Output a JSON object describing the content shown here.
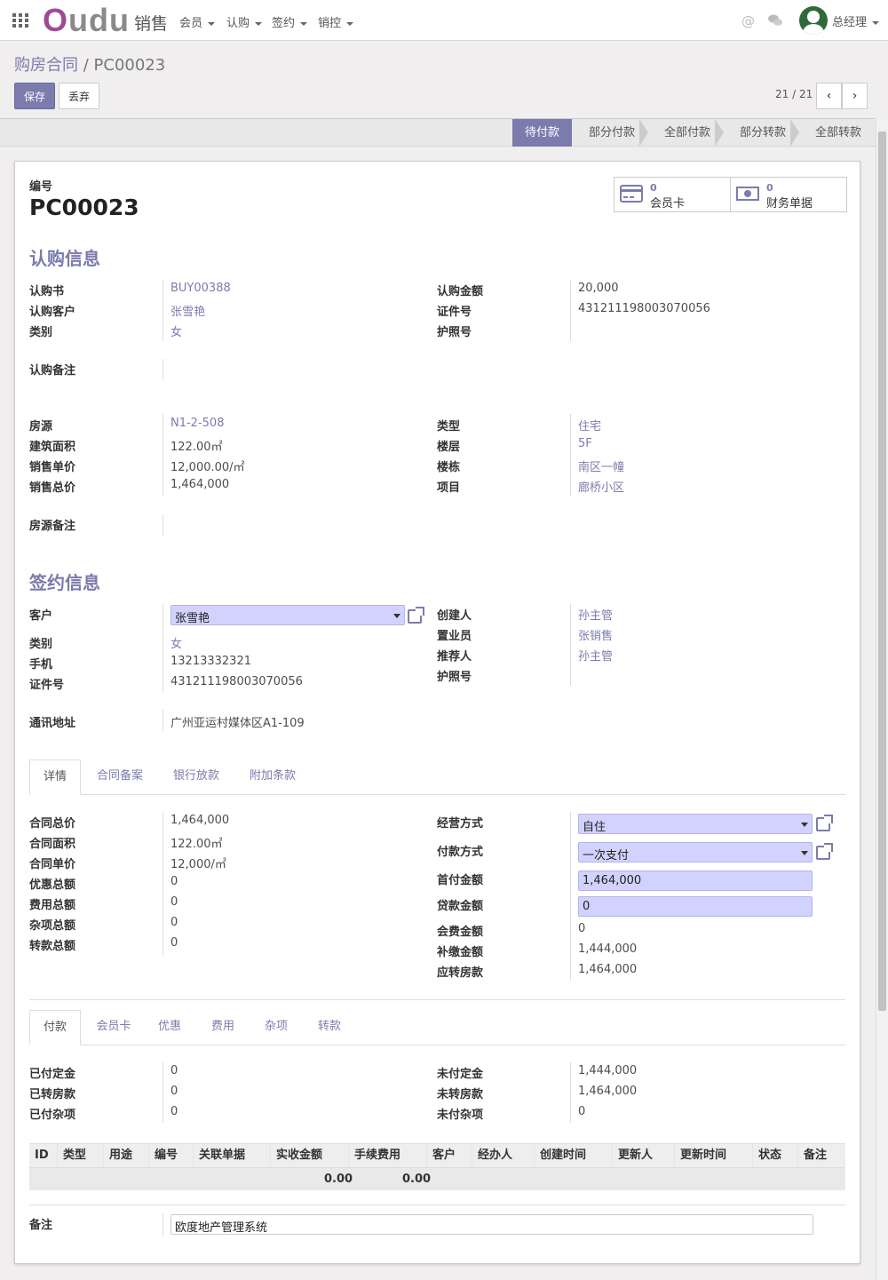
{
  "nav": {
    "logo_o": "O",
    "logo_rest": "udu",
    "app_name": "销售",
    "menus": [
      "会员",
      "认购",
      "签约",
      "销控"
    ],
    "user_name": "总经理"
  },
  "breadcrumb": {
    "parent": "购房合同",
    "sep": "/",
    "current": "PC00023"
  },
  "buttons": {
    "save": "保存",
    "discard": "丢弃"
  },
  "pager": {
    "text": "21 / 21"
  },
  "stages": [
    {
      "label": "待付款",
      "active": true
    },
    {
      "label": "部分付款",
      "active": false
    },
    {
      "label": "全部付款",
      "active": false
    },
    {
      "label": "部分转款",
      "active": false
    },
    {
      "label": "全部转款",
      "active": false
    }
  ],
  "smart_buttons": [
    {
      "count": "0",
      "label": "会员卡",
      "icon": "credit-card-icon"
    },
    {
      "count": "0",
      "label": "财务单据",
      "icon": "money-icon"
    }
  ],
  "header": {
    "code_label": "编号",
    "code": "PC00023"
  },
  "subscription": {
    "title": "认购信息",
    "left": [
      {
        "label": "认购书",
        "value": "BUY00388",
        "link": true
      },
      {
        "label": "认购客户",
        "value": "张雪艳",
        "link": true
      },
      {
        "label": "类别",
        "value": "女",
        "link": true
      }
    ],
    "right": [
      {
        "label": "认购金额",
        "value": "20,000",
        "link": false
      },
      {
        "label": "证件号",
        "value": "431211198003070056",
        "link": false
      },
      {
        "label": "护照号",
        "value": "",
        "link": false
      }
    ],
    "note_label": "认购备注"
  },
  "property": {
    "left": [
      {
        "label": "房源",
        "value": "N1-2-508",
        "link": true
      },
      {
        "label": "建筑面积",
        "value": "122.00㎡",
        "link": false
      },
      {
        "label": "销售单价",
        "value": "12,000.00/㎡",
        "link": false
      },
      {
        "label": "销售总价",
        "value": "1,464,000",
        "link": false
      }
    ],
    "right": [
      {
        "label": "类型",
        "value": "住宅",
        "link": true
      },
      {
        "label": "楼层",
        "value": "5F",
        "link": true
      },
      {
        "label": "楼栋",
        "value": "南区一幢",
        "link": true
      },
      {
        "label": "项目",
        "value": "廊桥小区",
        "link": true
      }
    ],
    "note_label": "房源备注"
  },
  "signing": {
    "title": "签约信息",
    "customer_label": "客户",
    "customer_value": "张雪艳",
    "left": [
      {
        "label": "类别",
        "value": "女",
        "link": true
      },
      {
        "label": "手机",
        "value": "13213332321",
        "link": false
      },
      {
        "label": "证件号",
        "value": "431211198003070056",
        "link": false
      }
    ],
    "right": [
      {
        "label": "创建人",
        "value": "孙主管",
        "link": true
      },
      {
        "label": "置业员",
        "value": "张销售",
        "link": true
      },
      {
        "label": "推荐人",
        "value": "孙主管",
        "link": true
      },
      {
        "label": "护照号",
        "value": "",
        "link": false
      }
    ],
    "address_label": "通讯地址",
    "address_value": "广州亚运村媒体区A1-109"
  },
  "tabs1": [
    "详情",
    "合同备案",
    "银行放款",
    "附加条款"
  ],
  "details": {
    "left": [
      {
        "label": "合同总价",
        "value": "1,464,000"
      },
      {
        "label": "合同面积",
        "value": "122.00㎡"
      },
      {
        "label": "合同单价",
        "value": "12,000/㎡"
      },
      {
        "label": "优惠总额",
        "value": "0"
      },
      {
        "label": "费用总额",
        "value": "0"
      },
      {
        "label": "杂项总额",
        "value": "0"
      },
      {
        "label": "转款总额",
        "value": "0"
      }
    ],
    "right_selects": [
      {
        "label": "经营方式",
        "value": "自住"
      },
      {
        "label": "付款方式",
        "value": "一次支付"
      }
    ],
    "right_inputs": [
      {
        "label": "首付金额",
        "value": "1,464,000"
      },
      {
        "label": "贷款金额",
        "value": "0"
      }
    ],
    "right_values": [
      {
        "label": "会费金额",
        "value": "0"
      },
      {
        "label": "补缴金额",
        "value": "1,444,000"
      },
      {
        "label": "应转房款",
        "value": "1,464,000"
      }
    ]
  },
  "tabs2": [
    "付款",
    "会员卡",
    "优惠",
    "费用",
    "杂项",
    "转款"
  ],
  "payment": {
    "left": [
      {
        "label": "已付定金",
        "value": "0"
      },
      {
        "label": "已转房款",
        "value": "0"
      },
      {
        "label": "已付杂项",
        "value": "0"
      }
    ],
    "right": [
      {
        "label": "未付定金",
        "value": "1,444,000"
      },
      {
        "label": "未转房款",
        "value": "1,464,000"
      },
      {
        "label": "未付杂项",
        "value": "0"
      }
    ]
  },
  "table": {
    "columns": [
      "ID",
      "类型",
      "用途",
      "编号",
      "关联单据",
      "实收金额",
      "手续费用",
      "客户",
      "经办人",
      "创建时间",
      "更新人",
      "更新时间",
      "状态",
      "备注"
    ],
    "totals": [
      "0.00",
      "0.00"
    ]
  },
  "remark": {
    "label": "备注",
    "value": "欧度地产管理系统"
  }
}
